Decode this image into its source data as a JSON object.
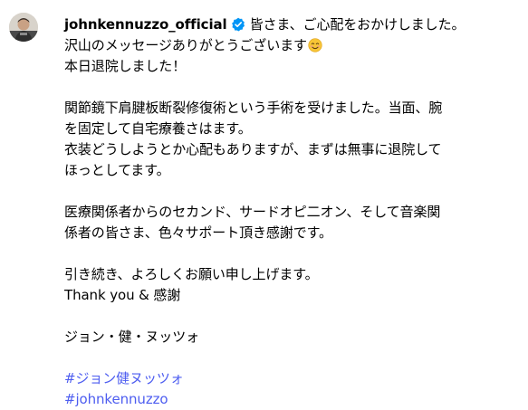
{
  "post": {
    "username": "johnkennuzzo_official",
    "verified_icon": "verified-badge-icon",
    "avatar_icon": "avatar",
    "emoji_icon": "smiling-face-emoji",
    "caption": {
      "line1": "皆さま、ご心配をおかけしました。",
      "line2": "沢山のメッセージありがとうございます",
      "line3": "本日退院しました！",
      "line4": "関節鏡下肩腱板断裂修復術という手術を受けました。当面、腕",
      "line5": "を固定して自宅療養さはます。",
      "line6": "衣装どうしようとか心配もありますが、まずは無事に退院して",
      "line7": "ほっとしてます。",
      "line8": "医療関係者からのセカンド、サードオピ二オン、そして音楽関",
      "line9": "係者の皆さま、色々サポート頂き感謝です。",
      "line10": "引き続き、よろしくお願い申し上げます。",
      "line11": "Thank you & 感謝",
      "line12": "ジョン・健・ヌッツォ"
    },
    "hashtags": [
      "#ジョン健ヌッツォ",
      "#johnkennuzzo"
    ],
    "colors": {
      "hashtag": "#4d5df0",
      "verified": "#0095f6",
      "text": "#000000"
    }
  }
}
